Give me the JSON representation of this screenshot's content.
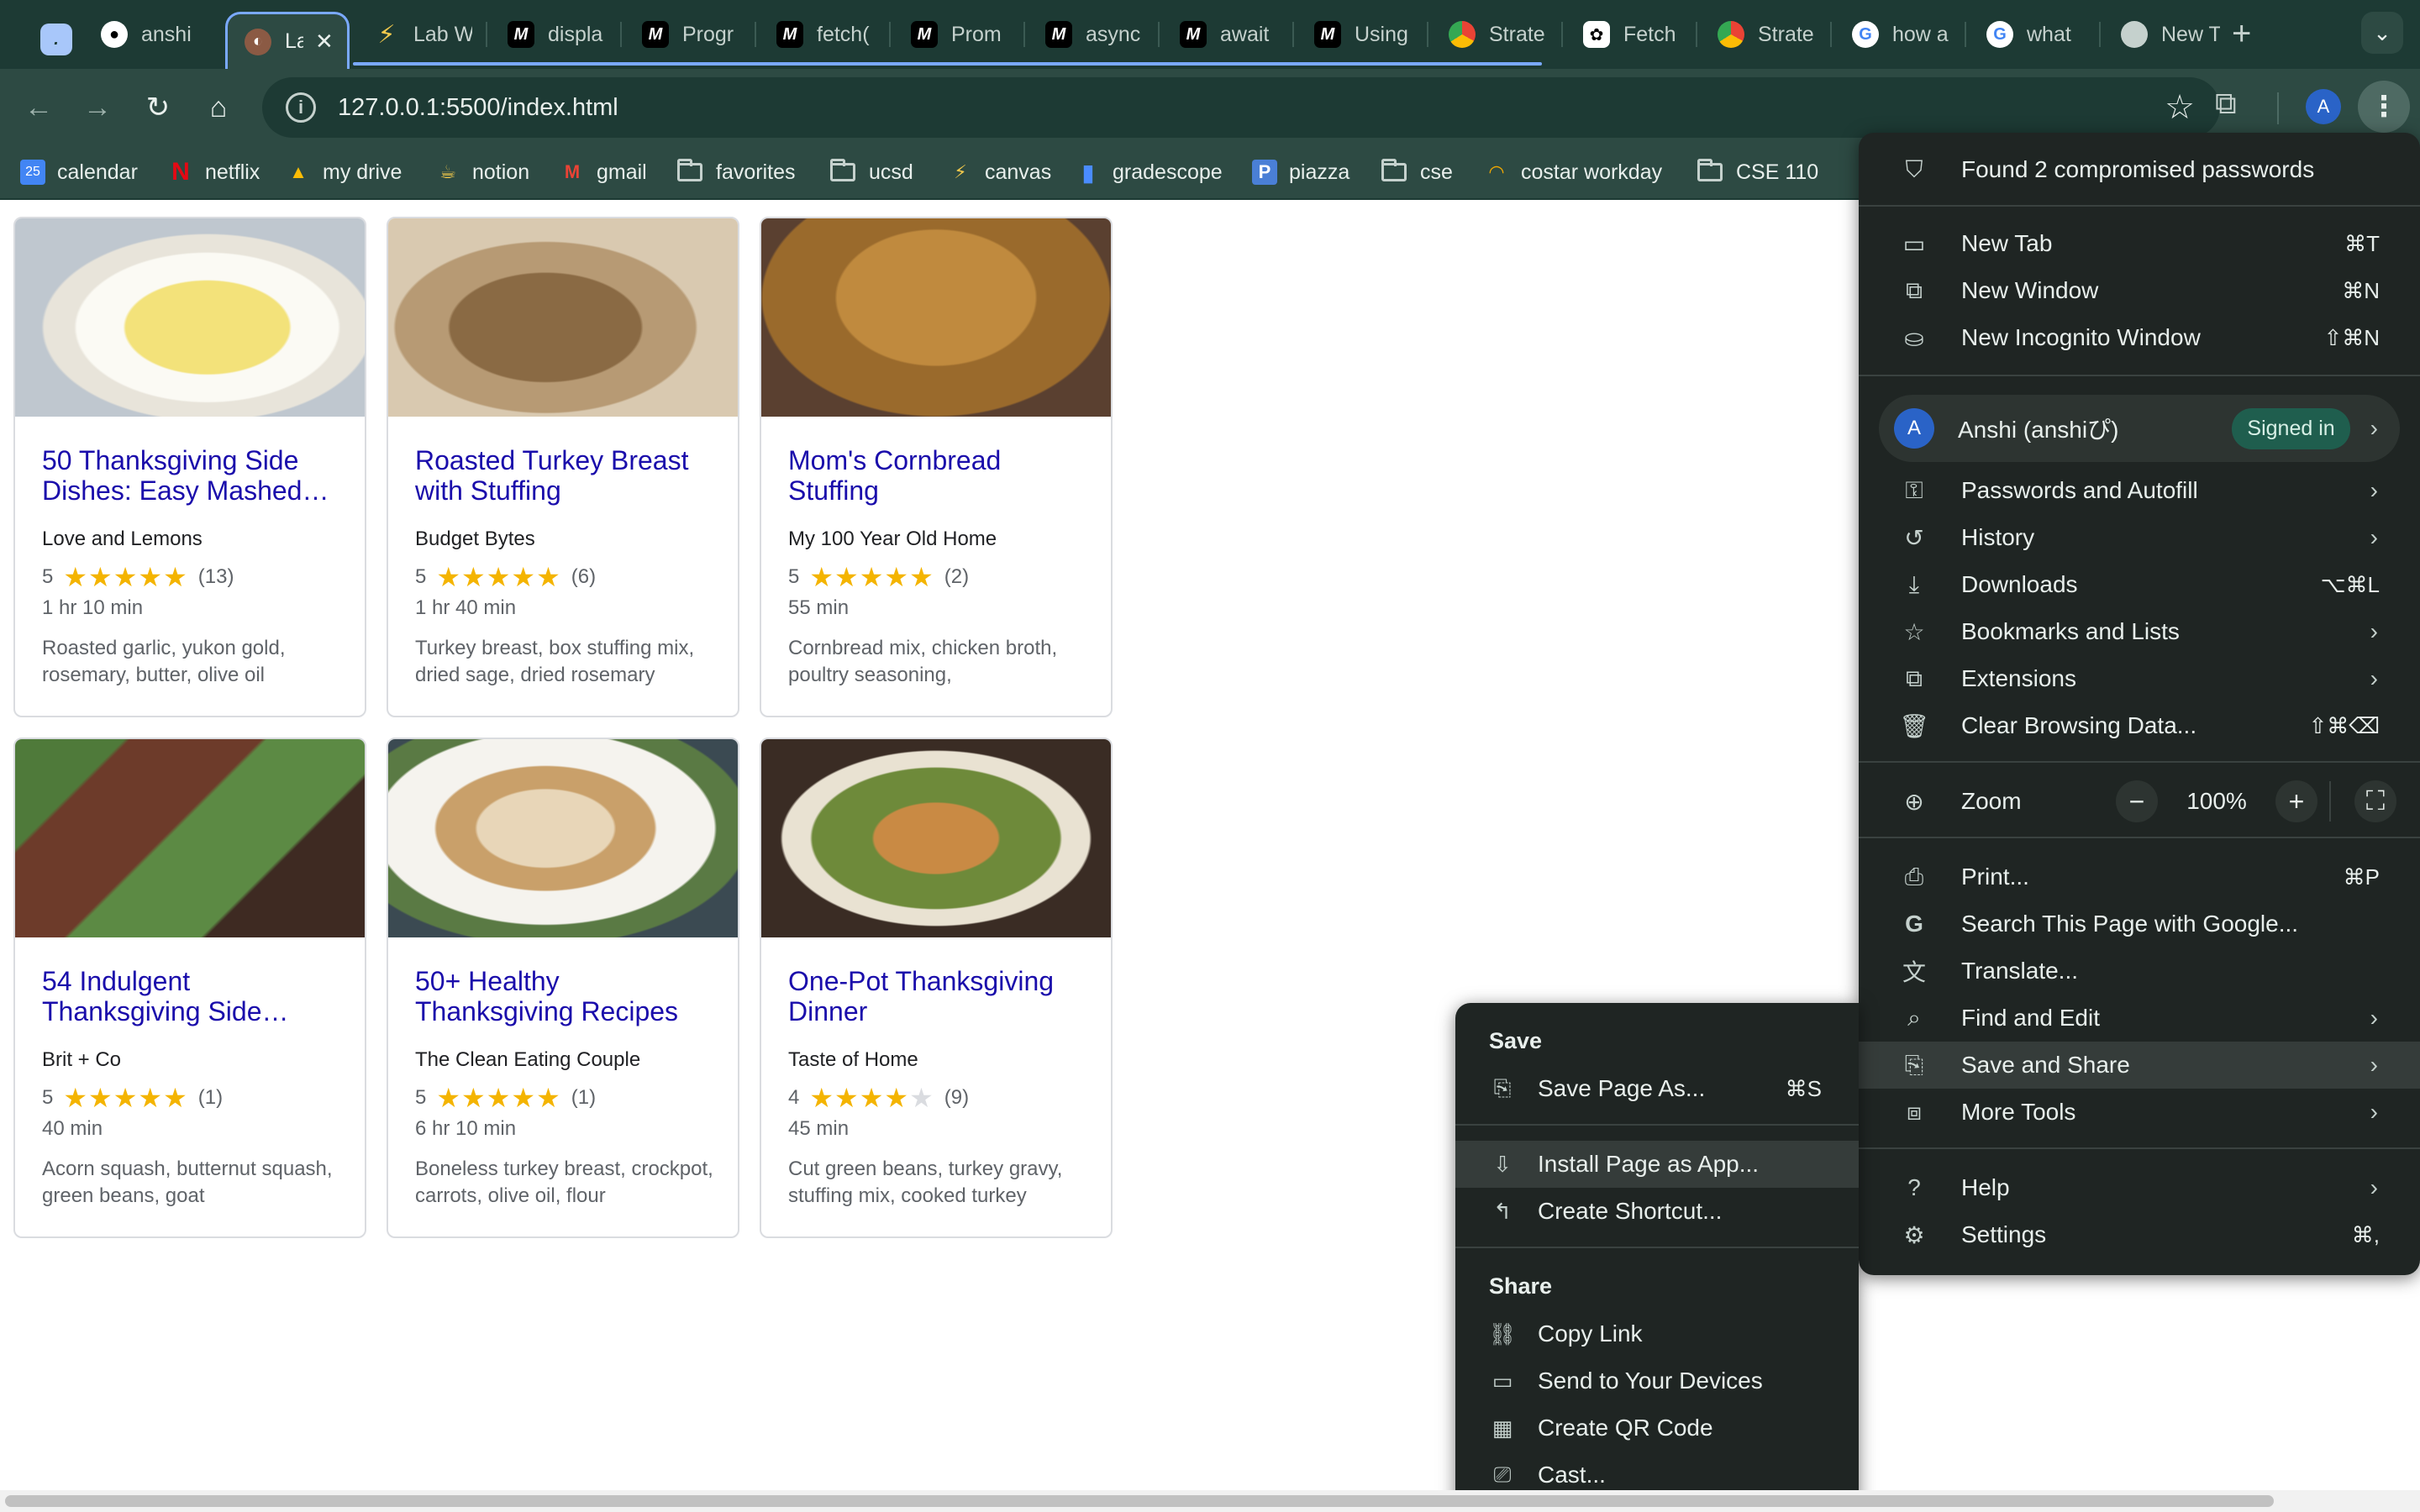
{
  "tabs": [
    {
      "title": "anshi",
      "icon": "github-icon"
    },
    {
      "title": "Lab",
      "icon": "turkey-icon",
      "active": true
    },
    {
      "title": "Lab W",
      "icon": "canvas-icon"
    },
    {
      "title": "displa",
      "icon": "mdn-icon"
    },
    {
      "title": "Progr",
      "icon": "mdn-icon"
    },
    {
      "title": "fetch(",
      "icon": "mdn-icon"
    },
    {
      "title": "Prom",
      "icon": "mdn-icon"
    },
    {
      "title": "async",
      "icon": "mdn-icon"
    },
    {
      "title": "await",
      "icon": "mdn-icon"
    },
    {
      "title": "Using",
      "icon": "mdn-icon"
    },
    {
      "title": "Strate",
      "icon": "chrome-icon"
    },
    {
      "title": "Fetch",
      "icon": "openai-icon"
    },
    {
      "title": "Strate",
      "icon": "chrome-icon"
    },
    {
      "title": "how a",
      "icon": "google-icon"
    },
    {
      "title": "what",
      "icon": "google-icon"
    },
    {
      "title": "New T",
      "icon": "chrome-icon"
    }
  ],
  "toolbar": {
    "url": "127.0.0.1:5500/index.html",
    "avatar_letter": "A"
  },
  "bookmarks": [
    {
      "label": "calendar",
      "icon": "calendar-icon"
    },
    {
      "label": "netflix",
      "icon": "netflix-icon"
    },
    {
      "label": "my drive",
      "icon": "drive-icon"
    },
    {
      "label": "notion",
      "icon": "notion-icon"
    },
    {
      "label": "gmail",
      "icon": "gmail-icon"
    },
    {
      "label": "favorites",
      "icon": "folder-icon"
    },
    {
      "label": "ucsd",
      "icon": "folder-icon"
    },
    {
      "label": "canvas",
      "icon": "canvas-icon"
    },
    {
      "label": "gradescope",
      "icon": "gradescope-icon"
    },
    {
      "label": "piazza",
      "icon": "piazza-icon"
    },
    {
      "label": "cse",
      "icon": "folder-icon"
    },
    {
      "label": "costar workday",
      "icon": "workday-icon"
    },
    {
      "label": "CSE 110",
      "icon": "folder-icon"
    }
  ],
  "recipes": [
    {
      "title": "50 Thanksgiving Side Dishes: Easy Mashed…",
      "source": "Love and Lemons",
      "rating": "5",
      "stars": 5,
      "count": "(13)",
      "time": "1 hr 10 min",
      "ingredients": "Roasted garlic, yukon gold, rosemary, butter, olive oil"
    },
    {
      "title": "Roasted Turkey Breast with Stuffing",
      "source": "Budget Bytes",
      "rating": "5",
      "stars": 5,
      "count": "(6)",
      "time": "1 hr 40 min",
      "ingredients": "Turkey breast, box stuffing mix, dried sage, dried rosemary"
    },
    {
      "title": "Mom's Cornbread Stuffing",
      "source": "My 100 Year Old Home",
      "rating": "5",
      "stars": 5,
      "count": "(2)",
      "time": "55 min",
      "ingredients": "Cornbread mix, chicken broth, poultry seasoning,"
    },
    {
      "title": "54 Indulgent Thanksgiving Side…",
      "source": "Brit + Co",
      "rating": "5",
      "stars": 5,
      "count": "(1)",
      "time": "40 min",
      "ingredients": "Acorn squash, butternut squash, green beans, goat"
    },
    {
      "title": "50+ Healthy Thanksgiving Recipes",
      "source": "The Clean Eating Couple",
      "rating": "5",
      "stars": 5,
      "count": "(1)",
      "time": "6 hr 10 min",
      "ingredients": "Boneless turkey breast, crockpot, carrots, olive oil, flour"
    },
    {
      "title": "One-Pot Thanksgiving Dinner",
      "source": "Taste of Home",
      "rating": "4",
      "stars": 4,
      "count": "(9)",
      "time": "45 min",
      "ingredients": "Cut green beans, turkey gravy, stuffing mix, cooked turkey"
    }
  ],
  "menu": {
    "compromised": "Found 2 compromised passwords",
    "new_tab": {
      "label": "New Tab",
      "shortcut": "⌘T"
    },
    "new_window": {
      "label": "New Window",
      "shortcut": "⌘N"
    },
    "new_incognito": {
      "label": "New Incognito Window",
      "shortcut": "⇧⌘N"
    },
    "profile": {
      "letter": "A",
      "name": "Anshi (anshiぴ)",
      "badge": "Signed in"
    },
    "passwords": {
      "label": "Passwords and Autofill"
    },
    "history": {
      "label": "History"
    },
    "downloads": {
      "label": "Downloads",
      "shortcut": "⌥⌘L"
    },
    "bookmarks": {
      "label": "Bookmarks and Lists"
    },
    "extensions": {
      "label": "Extensions"
    },
    "clear": {
      "label": "Clear Browsing Data...",
      "shortcut": "⇧⌘⌫"
    },
    "zoom": {
      "label": "Zoom",
      "value": "100%"
    },
    "print": {
      "label": "Print...",
      "shortcut": "⌘P"
    },
    "search_google": {
      "label": "Search This Page with Google..."
    },
    "translate": {
      "label": "Translate..."
    },
    "find_edit": {
      "label": "Find and Edit"
    },
    "save_share": {
      "label": "Save and Share"
    },
    "more_tools": {
      "label": "More Tools"
    },
    "help": {
      "label": "Help"
    },
    "settings": {
      "label": "Settings",
      "shortcut": "⌘,"
    }
  },
  "submenu": {
    "save_header": "Save",
    "save_page": {
      "label": "Save Page As...",
      "shortcut": "⌘S"
    },
    "install_app": {
      "label": "Install Page as App..."
    },
    "create_shortcut": {
      "label": "Create Shortcut..."
    },
    "share_header": "Share",
    "copy_link": {
      "label": "Copy Link"
    },
    "send_devices": {
      "label": "Send to Your Devices"
    },
    "qr_code": {
      "label": "Create QR Code"
    },
    "cast": {
      "label": "Cast..."
    }
  },
  "colors": {
    "tab_strip": "#1d3a34",
    "toolbar": "#2d4a43",
    "menu_bg": "#1f2523",
    "link": "#1a0dab",
    "star": "#f4b400"
  }
}
